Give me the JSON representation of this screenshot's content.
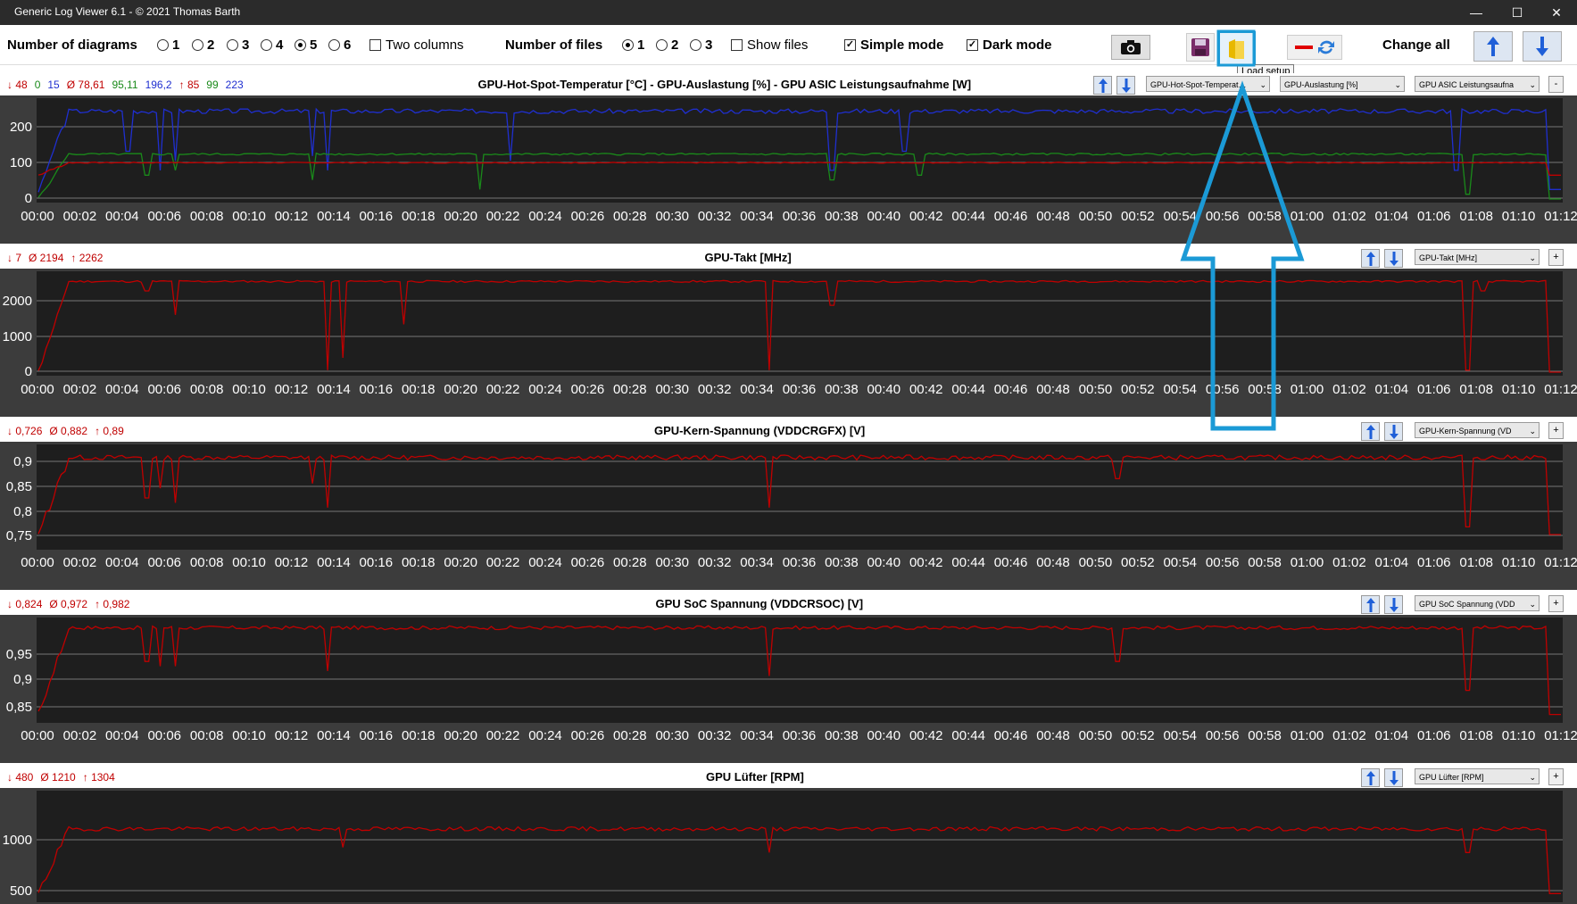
{
  "window": {
    "title": "Generic Log Viewer 6.1 - © 2021 Thomas Barth",
    "controls": [
      "—",
      "☐",
      "✕"
    ]
  },
  "toolbar": {
    "num_diagrams_label": "Number of diagrams",
    "diagram_options": [
      "1",
      "2",
      "3",
      "4",
      "5",
      "6"
    ],
    "diagram_selected": "5",
    "two_columns_label": "Two columns",
    "two_columns_checked": false,
    "num_files_label": "Number of files",
    "file_options": [
      "1",
      "2",
      "3"
    ],
    "file_selected": "1",
    "show_files_label": "Show files",
    "show_files_checked": false,
    "simple_mode_label": "Simple mode",
    "simple_mode_checked": true,
    "dark_mode_label": "Dark mode",
    "dark_mode_checked": true,
    "change_all_label": "Change all",
    "tooltip": "Load setup"
  },
  "time_ticks": [
    "00:00",
    "00:02",
    "00:04",
    "00:06",
    "00:08",
    "00:10",
    "00:12",
    "00:14",
    "00:16",
    "00:18",
    "00:20",
    "00:22",
    "00:24",
    "00:26",
    "00:28",
    "00:30",
    "00:32",
    "00:34",
    "00:36",
    "00:38",
    "00:40",
    "00:42",
    "00:44",
    "00:46",
    "00:48",
    "00:50",
    "00:52",
    "00:54",
    "00:56",
    "00:58",
    "01:00",
    "01:02",
    "01:04",
    "01:06",
    "01:08",
    "01:10",
    "01:12"
  ],
  "colors": {
    "red": "#c00000",
    "green": "#1a8a1a",
    "blue": "#1f2fd0",
    "plot_bg": "#1e1e1e",
    "panel_bg": "#3c3c3c"
  },
  "panels": [
    {
      "title": "GPU-Hot-Spot-Temperatur [°C]  -  GPU-Auslastung [%]  -  GPU ASIC Leistungsaufnahme [W]",
      "stats": [
        {
          "text": "↓ 48",
          "color": "red"
        },
        {
          "text": "0",
          "color": "green"
        },
        {
          "text": "15",
          "color": "blue"
        },
        {
          "text": "Ø 78,61",
          "color": "red"
        },
        {
          "text": "95,11",
          "color": "green"
        },
        {
          "text": "196,2",
          "color": "blue"
        },
        {
          "text": "↑ 85",
          "color": "red"
        },
        {
          "text": "99",
          "color": "green"
        },
        {
          "text": "223",
          "color": "blue"
        }
      ],
      "selects": [
        "GPU-Hot-Spot-Temperat…",
        "GPU-Auslastung [%]",
        "GPU ASIC Leistungsaufna"
      ],
      "mini_button": "-",
      "y_ticks": [
        "200",
        "100",
        "0"
      ]
    },
    {
      "title": "GPU-Takt [MHz]",
      "stats": [
        {
          "text": "↓ 7",
          "color": "red"
        },
        {
          "text": "Ø 2194",
          "color": "red"
        },
        {
          "text": "↑ 2262",
          "color": "red"
        }
      ],
      "selects": [
        "GPU-Takt [MHz]"
      ],
      "mini_button": "+",
      "y_ticks": [
        "2000",
        "1000",
        "0"
      ]
    },
    {
      "title": "GPU-Kern-Spannung (VDDCRGFX) [V]",
      "stats": [
        {
          "text": "↓ 0,726",
          "color": "red"
        },
        {
          "text": "Ø 0,882",
          "color": "red"
        },
        {
          "text": "↑ 0,89",
          "color": "red"
        }
      ],
      "selects": [
        "GPU-Kern-Spannung (VD"
      ],
      "mini_button": "+",
      "y_ticks": [
        "0,9",
        "0,85",
        "0,8",
        "0,75"
      ]
    },
    {
      "title": "GPU SoC Spannung (VDDCRSOC) [V]",
      "stats": [
        {
          "text": "↓ 0,824",
          "color": "red"
        },
        {
          "text": "Ø 0,972",
          "color": "red"
        },
        {
          "text": "↑ 0,982",
          "color": "red"
        }
      ],
      "selects": [
        "GPU SoC Spannung (VDD"
      ],
      "mini_button": "+",
      "y_ticks": [
        "0,95",
        "0,9",
        "0,85"
      ]
    },
    {
      "title": "GPU Lüfter [RPM]",
      "stats": [
        {
          "text": "↓ 480",
          "color": "red"
        },
        {
          "text": "Ø 1210",
          "color": "red"
        },
        {
          "text": "↑ 1304",
          "color": "red"
        }
      ],
      "selects": [
        "GPU Lüfter [RPM]"
      ],
      "mini_button": "+",
      "y_ticks": [
        "1000",
        "500"
      ]
    }
  ]
}
